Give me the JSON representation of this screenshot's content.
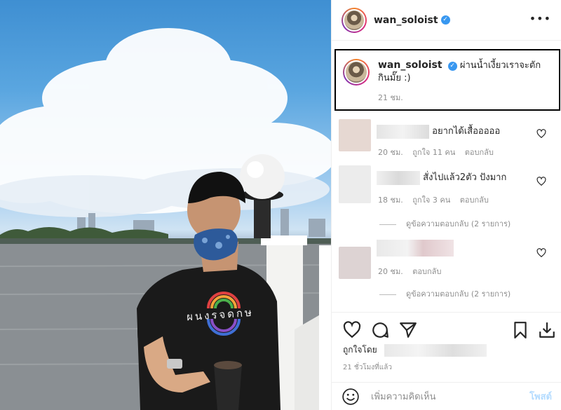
{
  "post": {
    "username": "wan_soloist",
    "verified_mark": "✓",
    "more_label": "•••",
    "caption_text": "ผ่านน้ำเงี้ยวเราจะตักกินมั๊ย :)",
    "caption_time": "21 ชม."
  },
  "comments": [
    {
      "text": "อยากได้เสื้อออออ",
      "time": "20 ชม.",
      "likes": "ถูกใจ 11 คน",
      "reply": "ตอบกลับ",
      "avatar_color": "#e6d8d2"
    },
    {
      "text": "สั่งไปแล้ว2ตัว ปังมาก",
      "time": "18 ชม.",
      "likes": "ถูกใจ 3 คน",
      "reply": "ตอบกลับ",
      "view_replies": "ดูข้อความตอบกลับ (2 รายการ)",
      "avatar_color": "#ececec"
    },
    {
      "text": "",
      "time": "20 ชม.",
      "reply": "ตอบกลับ",
      "view_replies": "ดูข้อความตอบกลับ (2 รายการ)",
      "avatar_color": "#ddd3d3"
    }
  ],
  "actions": {
    "icons": [
      "heart-icon",
      "comment-icon",
      "share-icon",
      "bookmark-icon",
      "download-icon"
    ]
  },
  "liked_by_label": "ถูกใจโดย",
  "post_time": "21 ชั่วโมงที่แล้ว",
  "comment_bar": {
    "placeholder": "เพิ่มความคิดเห็น",
    "post_label": "โพสต์"
  },
  "photo": {
    "shirt_text": "ผนงรจดกษ"
  },
  "colors": {
    "accent": "#3897f0",
    "post_button": "#b3dbff",
    "meta_text": "#8e8e8e"
  }
}
